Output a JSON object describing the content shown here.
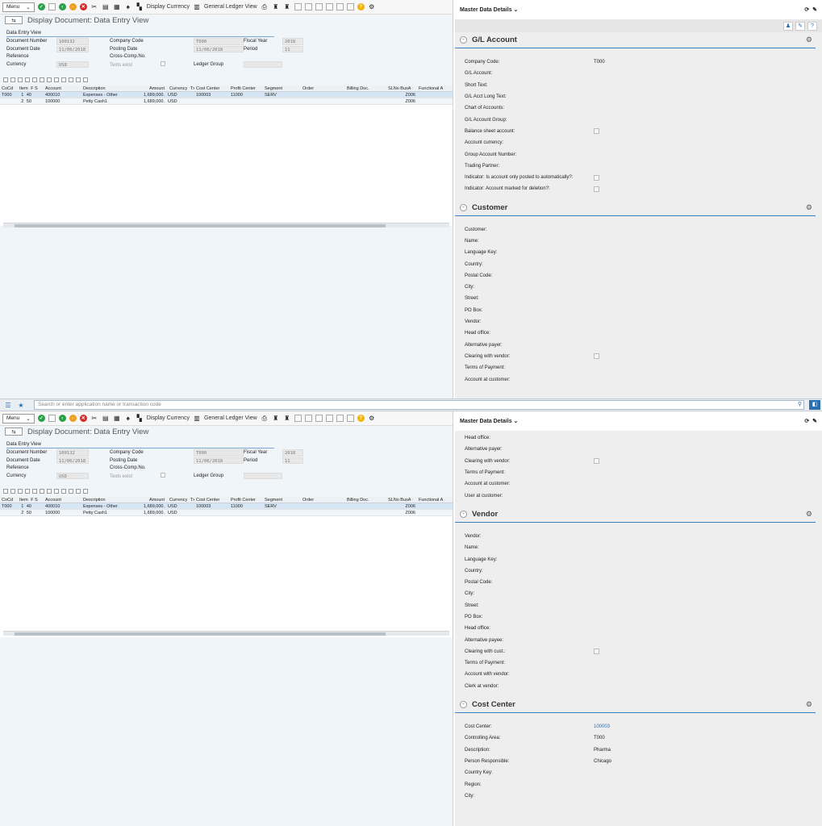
{
  "toolbar": {
    "menu_label": "Menu",
    "display_currency_label": "Display Currency",
    "general_ledger_view_label": "General Ledger View"
  },
  "document": {
    "title": "Display Document: Data Entry View",
    "header_caption": "Data Entry View",
    "labels": {
      "document_number": "Document Number",
      "company_code": "Company Code",
      "fiscal_year": "Fiscal Year",
      "document_date": "Document Date",
      "posting_date": "Posting Date",
      "period": "Period",
      "reference": "Reference",
      "cross_comp_no": "Cross-Comp.No.",
      "currency": "Currency",
      "texts_exist": "Texts exist",
      "ledger_group": "Ledger Group"
    },
    "values": {
      "document_number": "100132",
      "company_code": "T000",
      "fiscal_year": "2018",
      "document_date": "11/06/2018",
      "posting_date": "11/06/2018",
      "period": "11",
      "currency": "USD"
    }
  },
  "grid": {
    "columns": [
      "CoCd",
      "Item",
      "PK",
      "S",
      "Account",
      "Description",
      "Amount",
      "Currency",
      "Tx",
      "Cost Center",
      "Profit Center",
      "Segment",
      "Order",
      "Billing Doc.",
      "SLNo BusA",
      "Functional A"
    ],
    "rows": [
      {
        "cocd": "T000",
        "item": "1",
        "pk": "40",
        "account": "400010",
        "description": "Expenses - Other",
        "amount": "1,689,000.",
        "currency": "USD",
        "cost_center": "100003",
        "profit_center": "11000",
        "segment": "SERV",
        "busa": "Z006"
      },
      {
        "cocd": "",
        "item": "2",
        "pk": "50",
        "account": "100000",
        "description": "Petty Cash1",
        "amount": "1,689,000.",
        "currency": "USD",
        "cost_center": "",
        "profit_center": "",
        "segment": "",
        "busa": "Z006"
      }
    ]
  },
  "master_data": {
    "title": "Master Data Details",
    "gl_section": {
      "title": "G/L Account",
      "company_code_label": "Company Code:",
      "company_code_value": "T000",
      "labels": [
        "G/L Account:",
        "Short Text:",
        "G/L Acct Long Text:",
        "Chart of Accounts:",
        "G/L Account Group:"
      ],
      "balance_sheet_label": "Balance sheet account:",
      "labels2": [
        "Account currency:",
        "Group Account Number:",
        "Trading Partner:"
      ],
      "auto_post_label": "Indicator: Is account only posted to automatically?:",
      "deletion_label": "Indicator: Account marked for deletion?:"
    },
    "customer_section": {
      "title": "Customer",
      "labels": [
        "Customer:",
        "Name:",
        "Language Key:",
        "Country:",
        "Postal Code:",
        "City:",
        "Street:",
        "PO Box:",
        "Vendor:",
        "Head office:",
        "Alternative payer:"
      ],
      "clearing_label": "Clearing with vendor:",
      "labels2": [
        "Terms of Payment:",
        "Account at customer:"
      ],
      "user_label": "User at customer:"
    },
    "vendor_section": {
      "title": "Vendor",
      "labels": [
        "Vendor:",
        "Name:",
        "Language Key:",
        "Country:",
        "Postal Code:",
        "City:",
        "Street:",
        "PO Box:",
        "Head office:",
        "Alternative payee:"
      ],
      "clearing_label": "Clearing with cust.:",
      "labels2": [
        "Terms of Payment:",
        "Account with vendor:",
        "Clerk at vendor:"
      ]
    },
    "cost_center_section": {
      "title": "Cost Center",
      "rows": [
        {
          "label": "Cost Center:",
          "value": "100003"
        },
        {
          "label": "Controlling Area:",
          "value": "T000"
        },
        {
          "label": "Description:",
          "value": "Pharma"
        },
        {
          "label": "Person Responsible:",
          "value": "Chicago"
        },
        {
          "label": "Country Key:",
          "value": ""
        },
        {
          "label": "Region:",
          "value": ""
        },
        {
          "label": "City:",
          "value": ""
        }
      ]
    }
  },
  "shell": {
    "search_placeholder": "Search or enter application name or transaction code"
  }
}
